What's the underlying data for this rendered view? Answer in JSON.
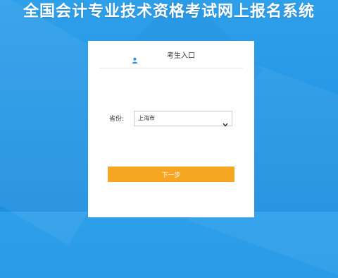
{
  "site": {
    "title": "全国会计专业技术资格考试网上报名系统"
  },
  "login": {
    "header_title": "考生入口",
    "province_label": "省份:",
    "province_value": "上海市",
    "next_button": "下一步"
  },
  "colors": {
    "background": "#2ea0ea",
    "button": "#f7a623",
    "card": "#ffffff",
    "user_icon": "#2d8ee0"
  },
  "icons": {
    "user": "user-icon",
    "dropdown": "chevron-down-icon"
  }
}
